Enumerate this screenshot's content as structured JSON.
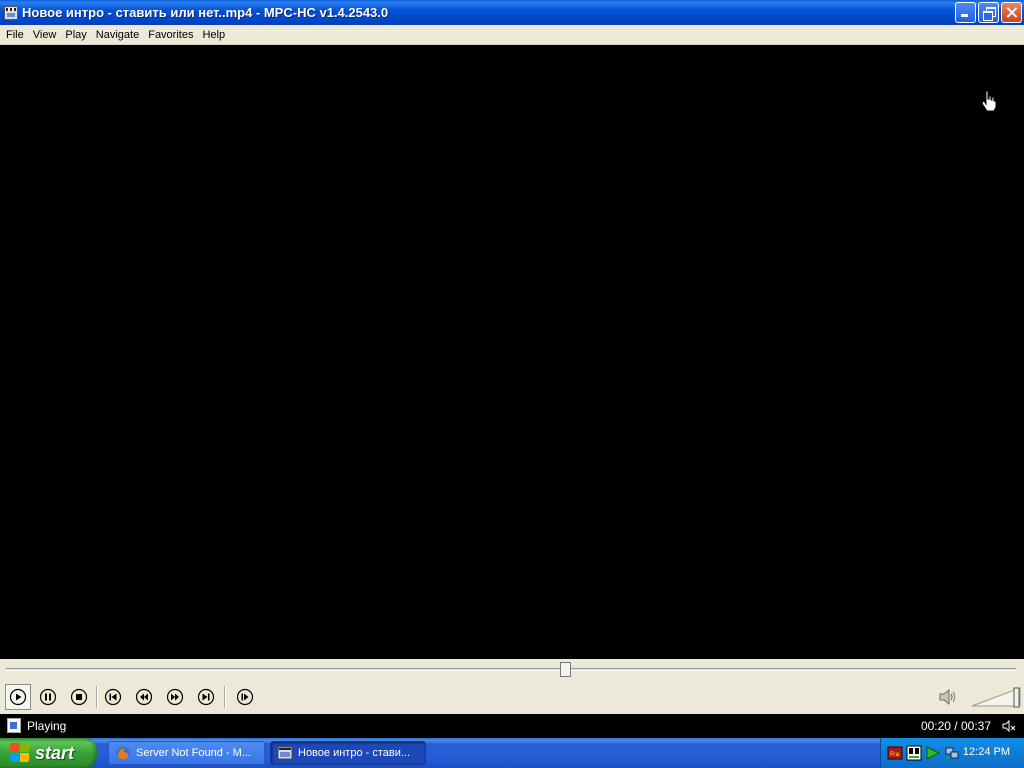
{
  "window": {
    "title": "Новое интро - ставить или нет..mp4 - MPC-HC v1.4.2543.0"
  },
  "menu": {
    "items": [
      "File",
      "View",
      "Play",
      "Navigate",
      "Favorites",
      "Help"
    ]
  },
  "playback": {
    "status": "Playing",
    "time": "00:20 / 00:37",
    "seek_fraction": 0.553,
    "volume_fraction": 1.0
  },
  "controls": {
    "buttons": [
      "play-icon",
      "pause-icon",
      "stop-icon",
      "prev-icon",
      "rewind-icon",
      "fast-forward-icon",
      "next-icon",
      "frame-step-icon"
    ]
  },
  "taskbar": {
    "start_label": "start",
    "tasks": [
      {
        "label": "Server Not Found - M...",
        "active": false
      },
      {
        "label": "Новое интро - стави...",
        "active": true
      }
    ],
    "clock": "12:24 PM"
  },
  "colors": {
    "titlebar": "#0553d6",
    "menu_bg": "#ece9d8",
    "video_bg": "#000000",
    "taskbar": "#245edb",
    "start_button": "#37a136"
  }
}
